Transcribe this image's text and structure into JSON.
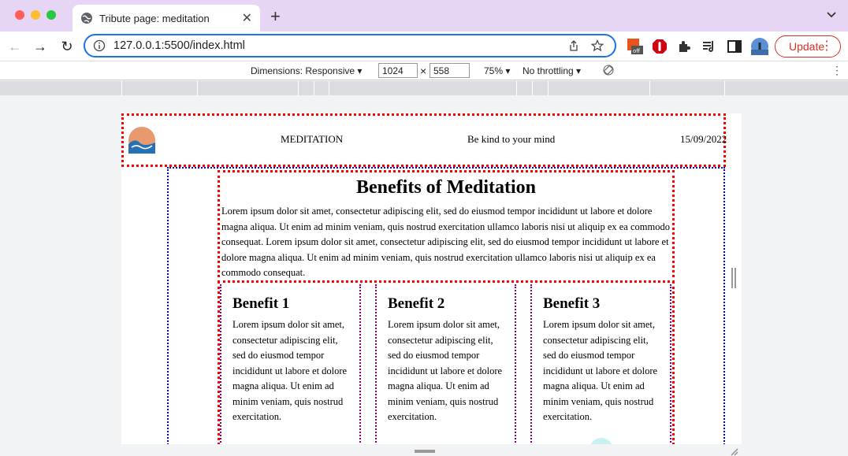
{
  "browser": {
    "tab_title": "Tribute page: meditation",
    "url": "127.0.0.1:5500/index.html",
    "update_label": "Update"
  },
  "devtools": {
    "dimensions_label": "Dimensions: Responsive",
    "width_value": "1024",
    "height_value": "558",
    "times": "×",
    "zoom": "75%",
    "throttling": "No throttling"
  },
  "page": {
    "header": {
      "nav_title": "MEDITATION",
      "tagline": "Be kind to your mind",
      "date": "15/09/2022"
    },
    "article": {
      "heading": "Benefits of Meditation",
      "body": "Lorem ipsum dolor sit amet, consectetur adipiscing elit, sed do eiusmod tempor incididunt ut labore et dolore magna aliqua. Ut enim ad minim veniam, quis nostrud exercitation ullamco laboris nisi ut aliquip ex ea commodo consequat. Lorem ipsum dolor sit amet, consectetur adipiscing elit, sed do eiusmod tempor incididunt ut labore et dolore magna aliqua. Ut enim ad minim veniam, quis nostrud exercitation ullamco laboris nisi ut aliquip ex ea commodo consequat."
    },
    "benefits": [
      {
        "title": "Benefit 1",
        "text": "Lorem ipsum dolor sit amet, consectetur adipiscing elit, sed do eiusmod tempor incididunt ut labore et dolore magna aliqua. Ut enim ad minim veniam, quis nostrud exercitation."
      },
      {
        "title": "Benefit 2",
        "text": "Lorem ipsum dolor sit amet, consectetur adipiscing elit, sed do eiusmod tempor incididunt ut labore et dolore magna aliqua. Ut enim ad minim veniam, quis nostrud exercitation."
      },
      {
        "title": "Benefit 3",
        "text": "Lorem ipsum dolor sit amet, consectetur adipiscing elit, sed do eiusmod tempor incididunt ut labore et dolore magna aliqua. Ut enim ad minim veniam, quis nostrud exercitation."
      }
    ]
  },
  "icons": {
    "tab_favicon": "globe-icon",
    "extension_off_badge": "off"
  },
  "colors": {
    "tabstrip": "#e7d5f5",
    "omnibox_border": "#1a73e8",
    "update": "#d93025",
    "debug_outline_header": "#ff0000",
    "debug_outline_main": "#0000cc",
    "debug_outline_card": "#800080"
  }
}
